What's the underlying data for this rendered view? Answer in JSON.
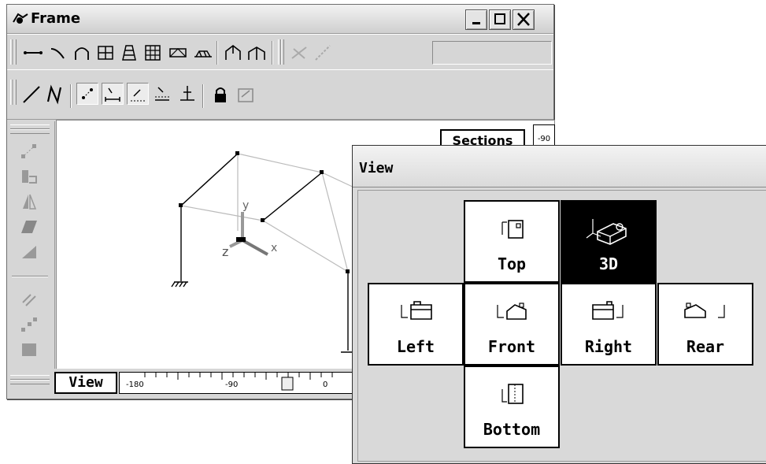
{
  "frame_window": {
    "title": "Frame",
    "sections_label": "Sections",
    "vertical_scale_label": "-90",
    "view_button_label": "View",
    "horizontal_scale": {
      "tick_labels": [
        "-180",
        "-90",
        "0"
      ],
      "slider_value": 0
    },
    "toolbar_row1_icons": [
      "line-icon",
      "curve-icon",
      "arch-icon",
      "grid-icon",
      "tower-icon",
      "grid-large-icon",
      "truss-icon",
      "bridge-icon",
      "portal-icon",
      "frame-icon",
      "node-link-icon",
      "diagonal-icon"
    ],
    "toolbar_row2_icons": [
      "line-draw-icon",
      "n-letter-icon",
      "snap-node-icon",
      "snap-dimension-icon",
      "snap-grid-icon",
      "snap-align-icon",
      "snap-level-icon",
      "lock-icon",
      "export-icon"
    ],
    "side_icons": [
      "nodes-icon",
      "rotate-icon",
      "mirror-icon",
      "skew-icon",
      "scale-icon",
      "stripe-icon",
      "move-nodes-icon",
      "fill-icon"
    ],
    "axes_labels": {
      "y": "y",
      "z": "z",
      "x": "x"
    }
  },
  "view_panel": {
    "title": "View",
    "cells": [
      {
        "id": "top",
        "label": "Top",
        "selected": false
      },
      {
        "id": "3d",
        "label": "3D",
        "selected": true
      },
      {
        "id": "left",
        "label": "Left",
        "selected": false
      },
      {
        "id": "front",
        "label": "Front",
        "selected": false
      },
      {
        "id": "right",
        "label": "Right",
        "selected": false
      },
      {
        "id": "rear",
        "label": "Rear",
        "selected": false
      },
      {
        "id": "bottom",
        "label": "Bottom",
        "selected": false
      }
    ]
  }
}
